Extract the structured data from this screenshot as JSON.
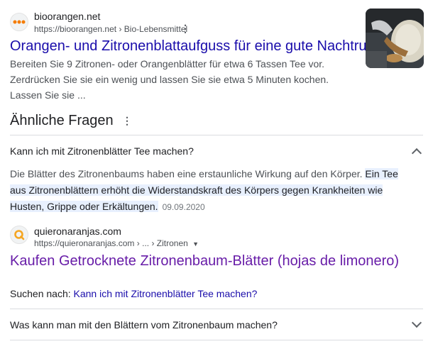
{
  "result1": {
    "site_name": "bioorangen.net",
    "url": "https://bioorangen.net",
    "breadcrumb": "Bio-Lebensmittel",
    "title": "Orangen- und Zitronenblattaufguss für eine gute Nachtruhe",
    "snippet": "Bereiten Sie 9 Zitronen- oder Orangenblätter für etwa 6 Tassen Tee vor. Zerdrücken Sie sie ein wenig und lassen Sie sie etwa 5 Minuten kochen. Lassen Sie sie ..."
  },
  "paa": {
    "heading": "Ähnliche Fragen",
    "q1": "Kann ich mit Zitronenblätter Tee machen?",
    "answer_plain": "Die Blätter des Zitronenbaums haben eine erstaunliche Wirkung auf den Körper. ",
    "answer_highlight": "Ein Tee aus Zitronenblättern erhöht die Widerstandskraft des Körpers gegen Krankheiten wie Husten, Grippe oder Erkältungen.",
    "answer_date": "09.09.2020",
    "source": {
      "site_name": "quieronaranjas.com",
      "url": "https://quieronaranjas.com",
      "path": "... › Zitronen",
      "title": "Kaufen Getrocknete Zitronenbaum-Blätter (hojas de limonero)"
    },
    "search_for_label": "Suchen nach:",
    "search_for_query": "Kann ich mit Zitronenblätter Tee machen?",
    "q2": "Was kann man mit den Blättern vom Zitronenbaum machen?"
  },
  "colors": {
    "link": "#1a0dab",
    "visited": "#681da8",
    "orange": "#f57c00"
  }
}
